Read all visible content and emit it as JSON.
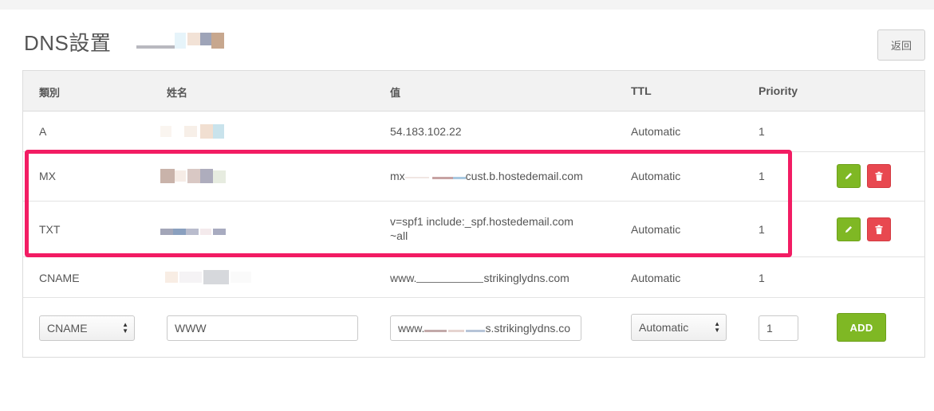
{
  "page": {
    "title": "DNS設置",
    "back_label": "返回"
  },
  "table": {
    "headers": {
      "type": "類別",
      "name": "姓名",
      "value": "值",
      "ttl": "TTL",
      "priority": "Priority"
    },
    "rows": [
      {
        "type": "A",
        "value": "54.183.102.22",
        "ttl": "Automatic",
        "priority": "1",
        "editable": false
      },
      {
        "type": "MX",
        "value_prefix": "mx",
        "value_suffix": "cust.b.hostedemail.com",
        "ttl": "Automatic",
        "priority": "1",
        "editable": true
      },
      {
        "type": "TXT",
        "value_line1": "v=spf1 include:_spf.hostedemail.com",
        "value_line2": "~all",
        "ttl": "Automatic",
        "priority": "1",
        "editable": true
      },
      {
        "type": "CNAME",
        "value_prefix": "www.",
        "value_suffix": "strikinglydns.com",
        "ttl": "Automatic",
        "priority": "1",
        "editable": false
      }
    ]
  },
  "new_record": {
    "type_selected": "CNAME",
    "name_value": "WWW",
    "value_prefix": "www.",
    "value_suffix": "s.strikinglydns.co",
    "ttl_selected": "Automatic",
    "priority_value": "1",
    "add_label": "ADD"
  },
  "icons": {
    "edit": "pencil-icon",
    "delete": "trash-icon"
  },
  "colors": {
    "accent_green": "#7fb824",
    "danger_red": "#e84850",
    "highlight": "#f21c63"
  }
}
